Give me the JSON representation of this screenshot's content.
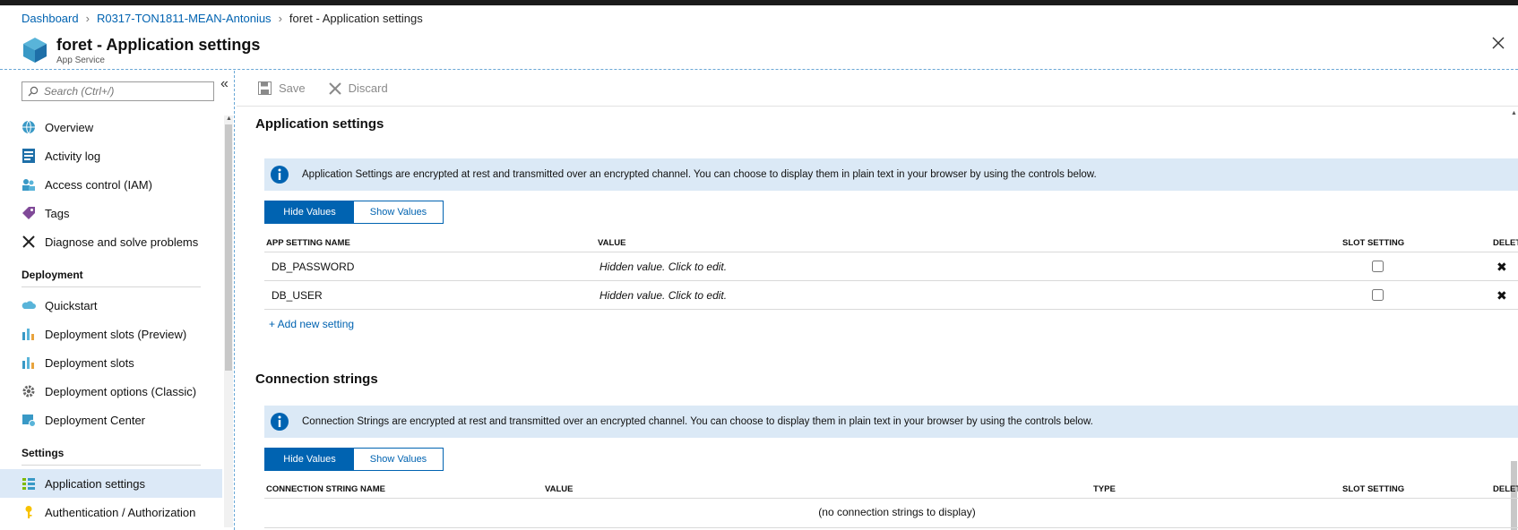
{
  "breadcrumb": {
    "items": [
      "Dashboard",
      "R0317-TON1811-MEAN-Antonius",
      "foret - Application settings"
    ]
  },
  "blade": {
    "title": "foret - Application settings",
    "subtitle": "App Service",
    "icon": "app-service-cube-icon"
  },
  "sidebar": {
    "search_placeholder": "Search (Ctrl+/)",
    "collapse_glyph": "«",
    "items": [
      {
        "label": "Overview",
        "icon": "globe-icon"
      },
      {
        "label": "Activity log",
        "icon": "activity-log-icon"
      },
      {
        "label": "Access control (IAM)",
        "icon": "people-icon"
      },
      {
        "label": "Tags",
        "icon": "tag-icon"
      },
      {
        "label": "Diagnose and solve problems",
        "icon": "wrench-icon"
      }
    ],
    "sections": [
      {
        "title": "Deployment",
        "items": [
          {
            "label": "Quickstart",
            "icon": "cloud-icon"
          },
          {
            "label": "Deployment slots (Preview)",
            "icon": "slots-icon"
          },
          {
            "label": "Deployment slots",
            "icon": "slots-icon"
          },
          {
            "label": "Deployment options (Classic)",
            "icon": "gear-icon"
          },
          {
            "label": "Deployment Center",
            "icon": "deployment-center-icon"
          }
        ]
      },
      {
        "title": "Settings",
        "items": [
          {
            "label": "Application settings",
            "icon": "list-icon",
            "active": true
          },
          {
            "label": "Authentication / Authorization",
            "icon": "key-icon"
          }
        ]
      }
    ]
  },
  "toolbar": {
    "save_label": "Save",
    "discard_label": "Discard"
  },
  "app_settings": {
    "title": "Application settings",
    "info": "Application Settings are encrypted at rest and transmitted over an encrypted channel. You can choose to display them in plain text in your browser by using the controls below.",
    "hide_label": "Hide Values",
    "show_label": "Show Values",
    "columns": {
      "name": "APP SETTING NAME",
      "value": "VALUE",
      "slot": "SLOT SETTING",
      "delete": "DELETE"
    },
    "rows": [
      {
        "name": "DB_PASSWORD",
        "value": "Hidden value. Click to edit.",
        "slot": false
      },
      {
        "name": "DB_USER",
        "value": "Hidden value. Click to edit.",
        "slot": false
      }
    ],
    "add_label": "+ Add new setting"
  },
  "conn_strings": {
    "title": "Connection strings",
    "info": "Connection Strings are encrypted at rest and transmitted over an encrypted channel. You can choose to display them in plain text in your browser by using the controls below.",
    "hide_label": "Hide Values",
    "show_label": "Show Values",
    "columns": {
      "name": "CONNECTION STRING NAME",
      "value": "VALUE",
      "type": "TYPE",
      "slot": "SLOT SETTING",
      "delete": "DELETE"
    },
    "empty": "(no connection strings to display)"
  },
  "colors": {
    "accent": "#0063b1",
    "banner": "#dbe9f6",
    "active_nav": "#dce9f7"
  }
}
